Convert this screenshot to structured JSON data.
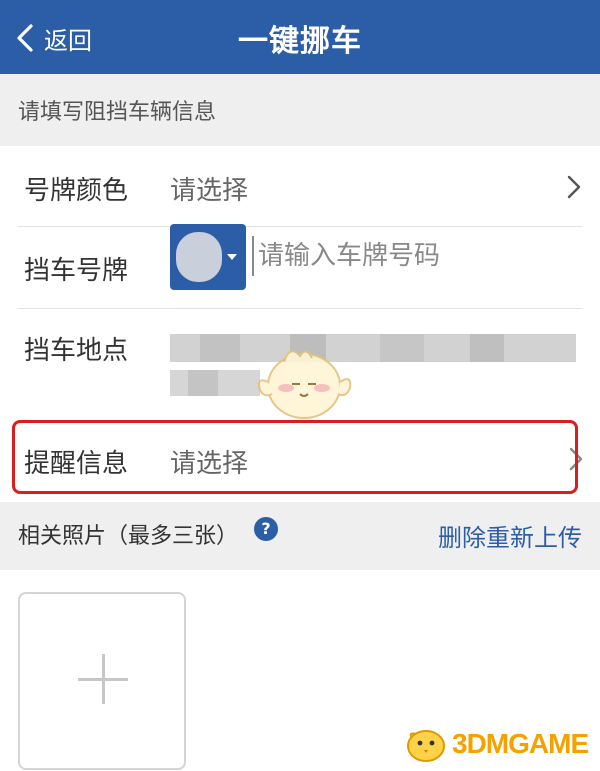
{
  "navbar": {
    "back_label": "返回",
    "title": "一键挪车",
    "background": "#2c5ea8"
  },
  "section_hint": "请填写阻挡车辆信息",
  "form": {
    "plate_color": {
      "label": "号牌颜色",
      "value": "请选择"
    },
    "plate_number": {
      "label": "挡车号牌",
      "placeholder": "请输入车牌号码"
    },
    "location": {
      "label": "挡车地点"
    },
    "reminder": {
      "label": "提醒信息",
      "value": "请选择"
    }
  },
  "photos": {
    "label": "相关照片（最多三张）",
    "help_icon": "?",
    "reupload_label": "删除重新上传"
  },
  "watermark": {
    "text": "3DMGAME",
    "color": "#f5a200"
  },
  "colors": {
    "accent": "#2c5ea8",
    "highlight": "#d81e1e"
  },
  "icons": [
    "chevron-left-icon",
    "chevron-right-icon",
    "caret-down-icon",
    "help-icon",
    "plus-icon"
  ]
}
